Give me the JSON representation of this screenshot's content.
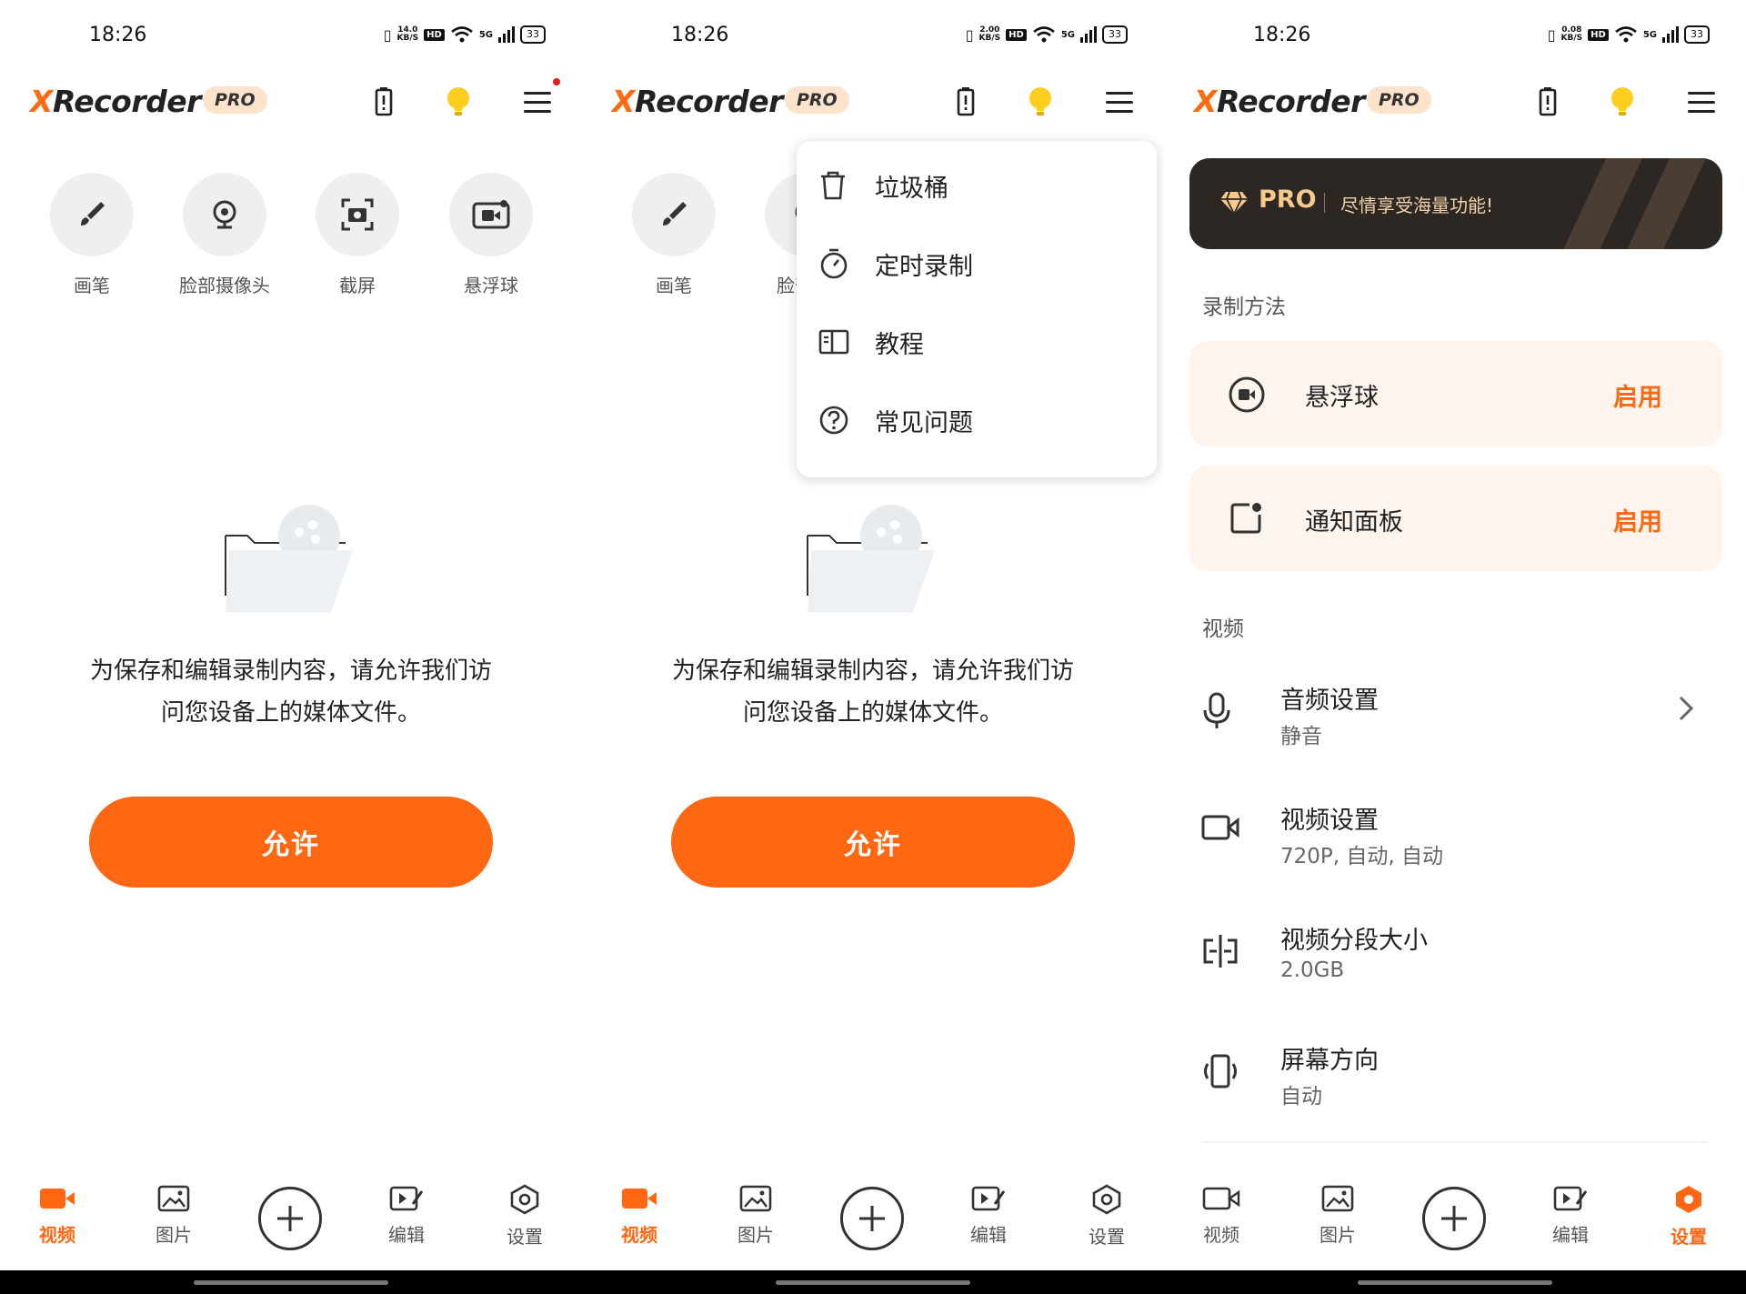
{
  "status": {
    "time": "18:26",
    "speeds": [
      "14.0",
      "2.00",
      "0.08"
    ],
    "speed_unit": "KB/S",
    "hd": "HD",
    "network": "5G",
    "battery": "33"
  },
  "brand": {
    "x": "X",
    "name": "Recorder",
    "pro": "PRO",
    "accent": "#ff6713"
  },
  "tools": [
    {
      "label": "画笔",
      "icon": "brush-icon"
    },
    {
      "label": "脸部摄像头",
      "icon": "webcam-icon"
    },
    {
      "label": "截屏",
      "icon": "screenshot-icon"
    },
    {
      "label": "悬浮球",
      "icon": "floating-ball-icon"
    }
  ],
  "tools_truncated": {
    "face_cam": "脸部"
  },
  "empty": {
    "line1": "为保存和编辑录制内容，请允许我们访",
    "line2": "问您设备上的媒体文件。",
    "allow": "允许"
  },
  "menu": [
    {
      "label": "垃圾桶",
      "icon": "trash-icon"
    },
    {
      "label": "定时录制",
      "icon": "timer-icon"
    },
    {
      "label": "教程",
      "icon": "book-icon"
    },
    {
      "label": "常见问题",
      "icon": "help-icon"
    }
  ],
  "nav": [
    {
      "label": "视频",
      "icon": "video-icon"
    },
    {
      "label": "图片",
      "icon": "image-icon"
    },
    {
      "label": "编辑",
      "icon": "edit-icon"
    },
    {
      "label": "设置",
      "icon": "settings-icon"
    }
  ],
  "settings": {
    "pro_banner": {
      "title": "PRO",
      "subtitle": "尽情享受海量功能!"
    },
    "section_method": "录制方法",
    "methods": [
      {
        "label": "悬浮球",
        "action": "启用"
      },
      {
        "label": "通知面板",
        "action": "启用"
      }
    ],
    "section_video": "视频",
    "rows": [
      {
        "title": "音频设置",
        "value": "静音"
      },
      {
        "title": "视频设置",
        "value": "720P, 自动, 自动"
      },
      {
        "title": "视频分段大小",
        "value": "2.0GB"
      },
      {
        "title": "屏幕方向",
        "value": "自动"
      }
    ]
  }
}
